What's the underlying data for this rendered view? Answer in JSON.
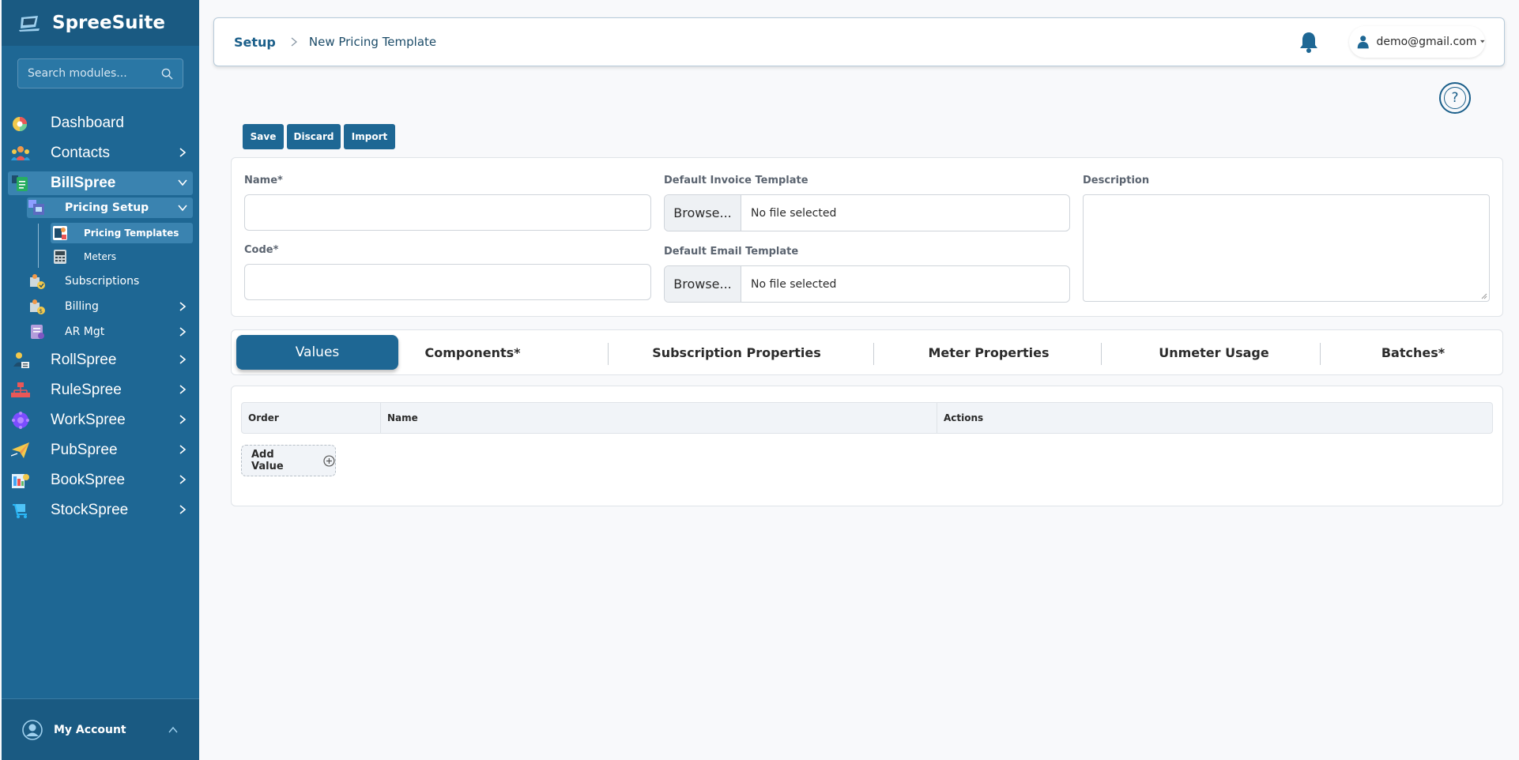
{
  "app": {
    "name": "SpreeSuite"
  },
  "sidebar": {
    "search_placeholder": "Search modules...",
    "items": [
      {
        "label": "Dashboard",
        "icon": "dashboard-pie-icon"
      },
      {
        "label": "Contacts",
        "icon": "contacts-icon"
      },
      {
        "label": "BillSpree",
        "icon": "billspree-icon"
      },
      {
        "label": "RollSpree",
        "icon": "rollspree-icon"
      },
      {
        "label": "RuleSpree",
        "icon": "rulespree-icon"
      },
      {
        "label": "WorkSpree",
        "icon": "workspree-icon"
      },
      {
        "label": "PubSpree",
        "icon": "pubspree-icon"
      },
      {
        "label": "BookSpree",
        "icon": "bookspree-icon"
      },
      {
        "label": "StockSpree",
        "icon": "stockspree-icon"
      }
    ],
    "billspree_sub": [
      {
        "label": "Pricing Setup"
      },
      {
        "label": "Subscriptions"
      },
      {
        "label": "Billing"
      },
      {
        "label": "AR Mgt"
      }
    ],
    "pricing_sub": [
      {
        "label": "Pricing Templates"
      },
      {
        "label": "Meters"
      }
    ],
    "account_label": "My Account"
  },
  "header": {
    "breadcrumb_root": "Setup",
    "breadcrumb_current": "New Pricing Template",
    "user_email": "demo@gmail.com"
  },
  "help": {
    "symbol": "?"
  },
  "toolbar": {
    "save": "Save",
    "discard": "Discard",
    "import": "Import"
  },
  "form": {
    "name_label": "Name*",
    "code_label": "Code*",
    "invoice_template_label": "Default Invoice Template",
    "email_template_label": "Default Email Template",
    "description_label": "Description",
    "browse_label": "Browse...",
    "no_file": "No file selected",
    "name_value": "",
    "code_value": ""
  },
  "tabs": [
    "Values",
    "Components*",
    "Subscription Properties",
    "Meter Properties",
    "Unmeter Usage",
    "Batches*"
  ],
  "table": {
    "columns": [
      "Order",
      "Name",
      "Actions"
    ],
    "rows": [],
    "add_label": "Add Value"
  },
  "colors": {
    "sidebar": "#1e6794",
    "sidebar_dark": "#1a5a82",
    "accent": "#1e6794",
    "active_item": "#3a83b0"
  }
}
